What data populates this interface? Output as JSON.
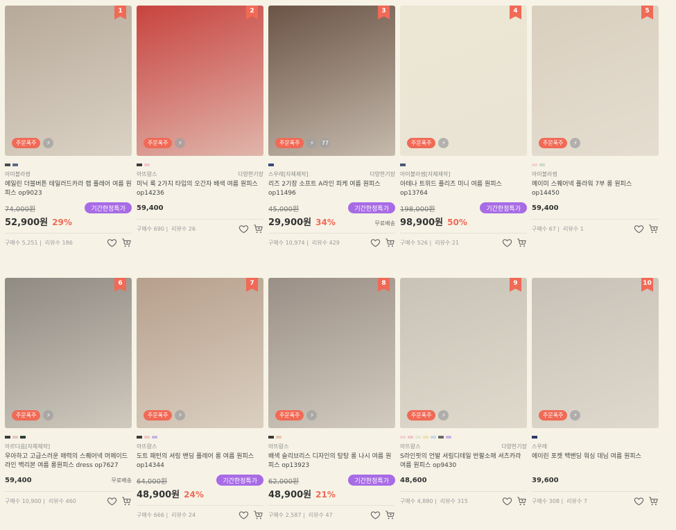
{
  "colors": {
    "background": "#f6f3e6",
    "rank": "#f06a56",
    "badge": "#f06a56",
    "sale_chip": "#a86be6",
    "discount": "#f06a56"
  },
  "labels": {
    "order_badge": "주문폭주",
    "sale_badge": "기간한정특가",
    "free_shipping": "무료배송",
    "buy_prefix": "구매수",
    "review_prefix": "리뷰수"
  },
  "products": [
    {
      "rank": "1",
      "swatches": [
        "#4a4a4a",
        "#5a6a8a"
      ],
      "brand": "아미볼라썸",
      "tag": "",
      "title": "에일린 더블버튼 테일러드카라 랩 플레어 여름 원피스 op9023",
      "orig_price": "74,000원",
      "final_price": "52,900원",
      "discount": "29%",
      "on_sale": true,
      "free_ship": false,
      "buys": "5,251",
      "reviews": "186",
      "extra_badge": "",
      "image_bg": "#b7a99a"
    },
    {
      "rank": "2",
      "swatches": [
        "#3a3a3a",
        "#f2c6cf"
      ],
      "brand": "아뜨랑스",
      "tag": "다양한기장",
      "title": "미닉 룩 2가지 타입의 오간자 배색 여름 원피스 op14236",
      "orig_price": "",
      "final_price": "59,400",
      "discount": "",
      "on_sale": false,
      "free_ship": false,
      "buys": "690",
      "reviews": "26",
      "extra_badge": "",
      "image_bg": "#c8433f"
    },
    {
      "rank": "3",
      "swatches": [
        "#3a4a7a"
      ],
      "brand": "스우레[자체제작]",
      "tag": "다양한기장",
      "title": "리즈 2기장 소프트 A라인 피케 여름 원피스 op11496",
      "orig_price": "45,000원",
      "final_price": "29,900원",
      "discount": "34%",
      "on_sale": true,
      "free_ship": true,
      "buys": "10,974",
      "reviews": "429",
      "extra_badge": "77",
      "image_bg": "#6b5446"
    },
    {
      "rank": "4",
      "swatches": [
        "#4a5a7a"
      ],
      "brand": "아미볼라썸[자체제작]",
      "tag": "",
      "title": "아테나 트위드 플리츠 미니 여름 원피스 op13764",
      "orig_price": "198,000원",
      "final_price": "98,900원",
      "discount": "50%",
      "on_sale": true,
      "free_ship": false,
      "buys": "526",
      "reviews": "21",
      "extra_badge": "",
      "image_bg": "#ece6d4"
    },
    {
      "rank": "5",
      "swatches": [
        "#f2d4d4",
        "#cfd9c6"
      ],
      "brand": "아미볼라썸",
      "tag": "",
      "title": "메이미 스퀘어넥 플라워 7부 롱 원피스 op14450",
      "orig_price": "",
      "final_price": "59,400",
      "discount": "",
      "on_sale": false,
      "free_ship": false,
      "buys": "67",
      "reviews": "1",
      "extra_badge": "",
      "image_bg": "#d9cfbf"
    },
    {
      "rank": "6",
      "swatches": [
        "#3a3a3a",
        "#e6c4c4",
        "#2f3f3a"
      ],
      "brand": "아르다옴[자체제작]",
      "tag": "",
      "title": "우아하고 고급스러운 매력의 스퀘어넥 머메이드라인 백리본 여름 롱원피스 dress op7627",
      "orig_price": "",
      "final_price": "59,400",
      "discount": "",
      "on_sale": false,
      "free_ship": true,
      "buys": "10,900",
      "reviews": "460",
      "extra_badge": "",
      "image_bg": "#8f8a82"
    },
    {
      "rank": "7",
      "swatches": [
        "#3a3a3a",
        "#f0c6c6",
        "#c9b6e6"
      ],
      "brand": "아뜨랑스",
      "tag": "",
      "title": "도트 패턴의 셔링 밴딩 플레어 롱 여름 원피스 op14344",
      "orig_price": "64,000원",
      "final_price": "48,900원",
      "discount": "24%",
      "on_sale": true,
      "free_ship": false,
      "buys": "666",
      "reviews": "24",
      "extra_badge": "",
      "image_bg": "#b79f8c"
    },
    {
      "rank": "8",
      "swatches": [
        "#3a3a3a",
        "#e6c9b0"
      ],
      "brand": "아뜨랑스",
      "tag": "",
      "title": "배색 슬리브리스 디자인의 탕탕 롱 나시 여름 원피스 op13923",
      "orig_price": "62,000원",
      "final_price": "48,900원",
      "discount": "21%",
      "on_sale": true,
      "free_ship": false,
      "buys": "2,587",
      "reviews": "47",
      "extra_badge": "",
      "image_bg": "#9a8f86"
    },
    {
      "rank": "9",
      "swatches": [
        "#f2d4d4",
        "#f2c6cf",
        "#e6e6d4",
        "#f2e0b0",
        "#c6d9e6",
        "#6a6a6a",
        "#c9b6e6"
      ],
      "brand": "아뜨랑스",
      "tag": "다양한기장",
      "title": "S라인핏의 언발 셔링디테일 반팔소매 셔츠카라 여름 원피스 op9430",
      "orig_price": "",
      "final_price": "48,600",
      "discount": "",
      "on_sale": false,
      "free_ship": false,
      "buys": "4,880",
      "reviews": "315",
      "extra_badge": "",
      "image_bg": "#c9c2b6"
    },
    {
      "rank": "10",
      "swatches": [
        "#2f3a6a"
      ],
      "brand": "스우레",
      "tag": "",
      "title": "에이린 포켓 백밴딩 워싱 데님 여름 원피스",
      "orig_price": "",
      "final_price": "39,600",
      "discount": "",
      "on_sale": false,
      "free_ship": false,
      "buys": "308",
      "reviews": "7",
      "extra_badge": "",
      "image_bg": "#c7c1b7"
    }
  ]
}
